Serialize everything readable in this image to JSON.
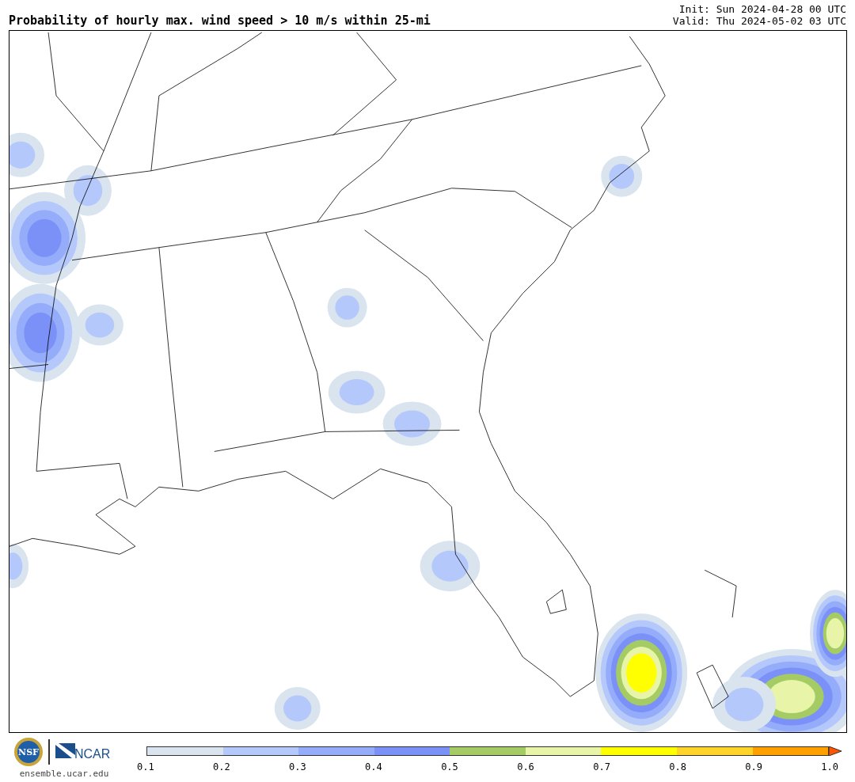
{
  "title": "Probability of hourly max. wind speed > 10 m/s within 25-mi",
  "init": "Init: Sun 2024-04-28 00 UTC",
  "valid": "Valid: Thu 2024-05-02 03 UTC",
  "colorbar": {
    "segments": [
      {
        "color": "#d9e4ef"
      },
      {
        "color": "#b4c8fb"
      },
      {
        "color": "#94acfa"
      },
      {
        "color": "#7b91f8"
      },
      {
        "color": "#a5cc64"
      },
      {
        "color": "#e8f5a8"
      },
      {
        "color": "#ffff00"
      },
      {
        "color": "#ffd42a"
      },
      {
        "color": "#ff9f00"
      },
      {
        "kind": "arrow",
        "color": "#ff5500"
      }
    ],
    "ticks": [
      "0.1",
      "0.2",
      "0.3",
      "0.4",
      "0.5",
      "0.6",
      "0.7",
      "0.8",
      "0.9",
      "1.0"
    ]
  },
  "logos": {
    "nsf": "NSF",
    "ncar": "NCAR"
  },
  "site": "ensemble.ucar.edu"
}
